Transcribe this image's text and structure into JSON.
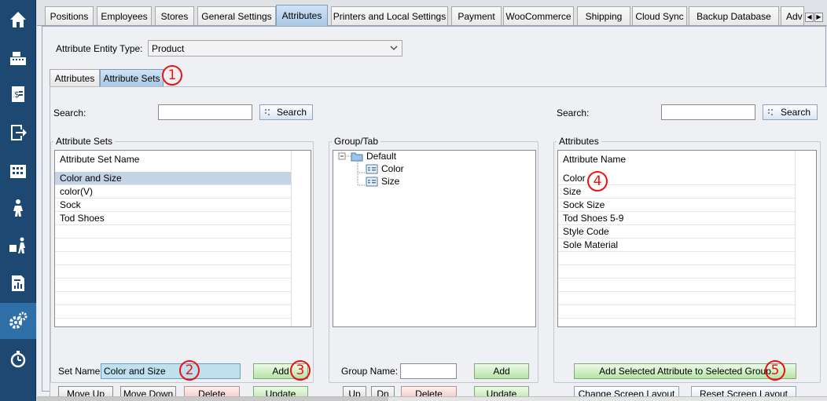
{
  "tabs": [
    "Positions",
    "Employees",
    "Stores",
    "General Settings",
    "Attributes",
    "Printers and Local Settings",
    "Payment",
    "WooCommerce",
    "Shipping",
    "Cloud Sync",
    "Backup Database",
    "Adv"
  ],
  "active_tab": "Attributes",
  "sidebar_icons": [
    "home-icon",
    "register-icon",
    "price-tag-icon",
    "exit-icon",
    "inventory-icon",
    "customers-icon",
    "delivery-icon",
    "reports-icon",
    "settings-icon",
    "timer-icon"
  ],
  "entity_type": {
    "label": "Attribute Entity Type:",
    "value": "Product"
  },
  "subtabs": [
    "Attributes",
    "Attribute Sets"
  ],
  "left_search": {
    "label": "Search:",
    "value": "",
    "button": "Search"
  },
  "right_search": {
    "label": "Search:",
    "value": "",
    "button": "Search"
  },
  "attribute_sets": {
    "legend": "Attribute Sets",
    "header": "Attribute Set Name",
    "rows": [
      "Color and Size",
      "color(V)",
      "Sock",
      "Tod Shoes"
    ],
    "selected": "Color and Size",
    "set_name_label": "Set Name:",
    "set_name_value": "Color and Size",
    "add": "Add",
    "move_up": "Move Up",
    "move_down": "Move Down",
    "delete": "Delete",
    "update": "Update"
  },
  "group_tab": {
    "legend": "Group/Tab",
    "root": "Default",
    "children": [
      "Color",
      "Size"
    ],
    "group_name_label": "Group Name:",
    "group_name_value": "",
    "add": "Add",
    "up": "Up",
    "dn": "Dn",
    "delete": "Delete",
    "update": "Update"
  },
  "attributes": {
    "legend": "Attributes",
    "header": "Attribute Name",
    "rows": [
      "Color",
      "Size",
      "Sock Size",
      "Tod Shoes 5-9",
      "Style Code",
      "Sole Material"
    ],
    "add_to_group": "Add Selected Attribute to Selected Group",
    "change_layout": "Change Screen Layout",
    "reset_layout": "Reset Screen Layout"
  },
  "callouts": [
    "1",
    "2",
    "3",
    "4",
    "5"
  ],
  "colors": {
    "sidebar": "#1d4872",
    "sidebar_active": "#2f6fa7",
    "callout": "#ee1111",
    "selected_row": "#c5d3e6"
  }
}
